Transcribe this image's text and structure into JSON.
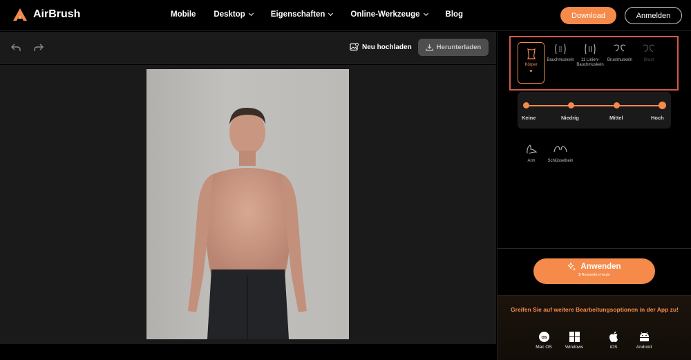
{
  "brand": {
    "name": "AirBrush",
    "accent": "#f58a4b"
  },
  "nav": {
    "items": [
      {
        "label": "Mobile",
        "dropdown": false
      },
      {
        "label": "Desktop",
        "dropdown": true
      },
      {
        "label": "Eigenschaften",
        "dropdown": true
      },
      {
        "label": "Online-Werkzeuge",
        "dropdown": true
      },
      {
        "label": "Blog",
        "dropdown": false
      }
    ],
    "download_label": "Download",
    "login_label": "Anmelden"
  },
  "toolbar": {
    "undo_icon": "undo-icon",
    "redo_icon": "redo-icon",
    "upload_label": "Neu hochladen",
    "download_label": "Herunterladen"
  },
  "panel": {
    "body_tools": [
      {
        "label": "Körper",
        "icon": "torso-icon",
        "active": true
      },
      {
        "label": "Bauchmuskeln",
        "icon": "abs-icon",
        "active": false
      },
      {
        "label": "11 Linien-Bauchmuskeln",
        "icon": "eleven-line-abs-icon",
        "active": false
      },
      {
        "label": "Brustmuskeln",
        "icon": "chest-icon",
        "active": false
      },
      {
        "label": "Brust",
        "icon": "breast-icon",
        "active": false,
        "disabled": true
      }
    ],
    "intensity": {
      "levels": [
        "Keine",
        "Niedrig",
        "Mittel",
        "Hoch"
      ],
      "selected": "Hoch"
    },
    "extra_tools": [
      {
        "label": "Arm",
        "icon": "arm-icon"
      },
      {
        "label": "Schlüsselbein",
        "icon": "collarbone-icon"
      }
    ],
    "apply": {
      "label": "Anwenden",
      "remaining_count": "3",
      "remaining_text": "Restzeiten heute"
    },
    "promo": {
      "text": "Greifen Sie auf weitere Bearbeitungsoptionen in der App zu!",
      "platforms": [
        {
          "label": "Mac OS",
          "icon": "macos-icon"
        },
        {
          "label": "Windows",
          "icon": "windows-icon"
        },
        {
          "label": "iOS",
          "icon": "apple-icon"
        },
        {
          "label": "Android",
          "icon": "android-icon"
        }
      ]
    }
  }
}
